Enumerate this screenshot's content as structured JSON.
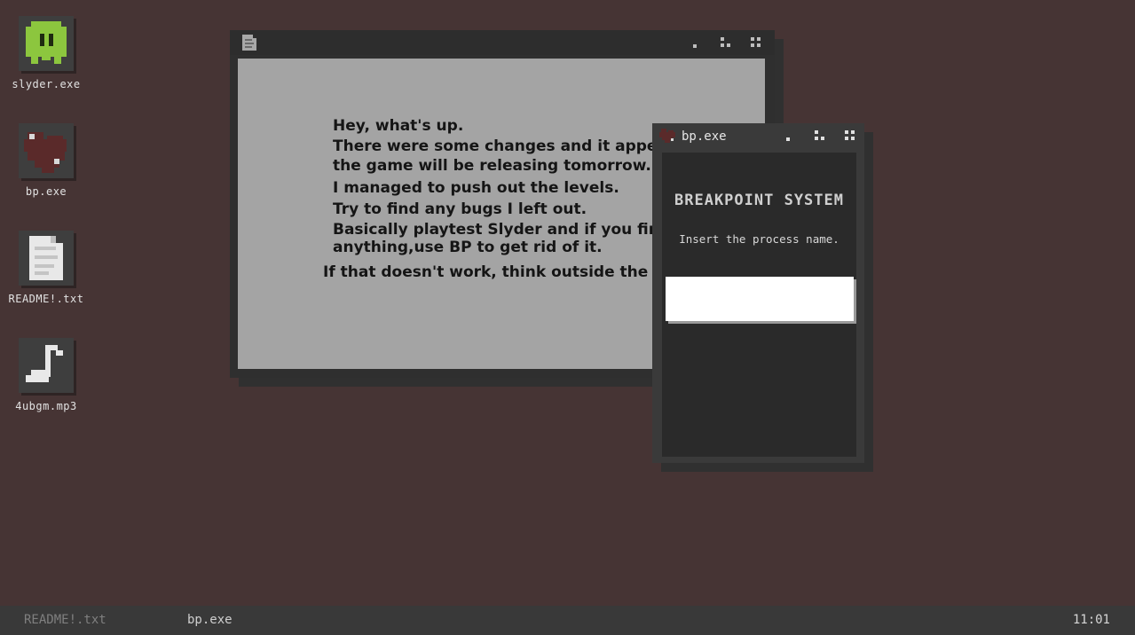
{
  "desktop_icons": [
    {
      "label": "slyder.exe",
      "icon": "slime-icon"
    },
    {
      "label": "bp.exe",
      "icon": "heart-icon"
    },
    {
      "label": "README!.txt",
      "icon": "document-icon"
    },
    {
      "label": "4ubgm.mp3",
      "icon": "music-note-icon"
    }
  ],
  "readme_window": {
    "title_icon": "document-icon",
    "lines": [
      "Hey, what's up.",
      "There were some changes and it appears",
      "the game will be releasing tomorrow.",
      "I managed to push out the levels.",
      "Try to find any bugs I left out.",
      "Basically playtest Slyder and if you find",
      "anything,use BP to get rid of it.",
      "If that doesn't work, think outside the box."
    ]
  },
  "bp_window": {
    "title": "bp.exe",
    "title_icon": "heart-icon",
    "heading": "BREAKPOINT SYSTEM",
    "instruction": "Insert the process name.",
    "input_value": "",
    "input_placeholder": ""
  },
  "taskbar": {
    "items": [
      "README!.txt",
      "bp.exe"
    ],
    "clock": "11:01"
  },
  "colors": {
    "desktop_bg": "#463434",
    "window_frame": "#2f2f2f",
    "readme_body": "#a4a4a4",
    "bp_body": "#2a2a2a",
    "taskbar_bg": "#393939",
    "slime_green": "#8cc63e",
    "heart_red": "#5a2a2a"
  }
}
